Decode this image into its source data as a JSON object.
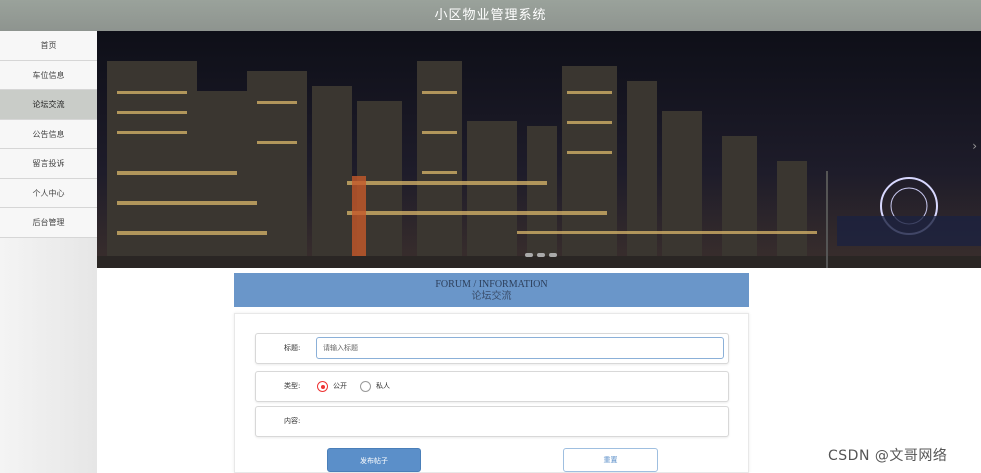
{
  "header": {
    "title": "小区物业管理系统"
  },
  "sidebar": {
    "items": [
      {
        "label": "首页",
        "active": false
      },
      {
        "label": "车位信息",
        "active": false
      },
      {
        "label": "论坛交流",
        "active": true
      },
      {
        "label": "公告信息",
        "active": false
      },
      {
        "label": "留言投诉",
        "active": false
      },
      {
        "label": "个人中心",
        "active": false
      },
      {
        "label": "后台管理",
        "active": false
      }
    ]
  },
  "banner": {
    "next_arrow": "›"
  },
  "forum": {
    "title_en": "FORUM / INFORMATION",
    "title_cn": "论坛交流"
  },
  "form": {
    "title_label": "标题:",
    "title_placeholder": "请输入标题",
    "type_label": "类型:",
    "type_options": [
      "公开",
      "私人"
    ],
    "type_selected": "公开",
    "content_label": "内容:",
    "submit_label": "发布帖子",
    "reset_label": "重置"
  },
  "watermark": "CSDN @文哥网络",
  "colors": {
    "header": "#959b96",
    "accent": "#5b8fc9",
    "radio_checked": "#e33333"
  }
}
